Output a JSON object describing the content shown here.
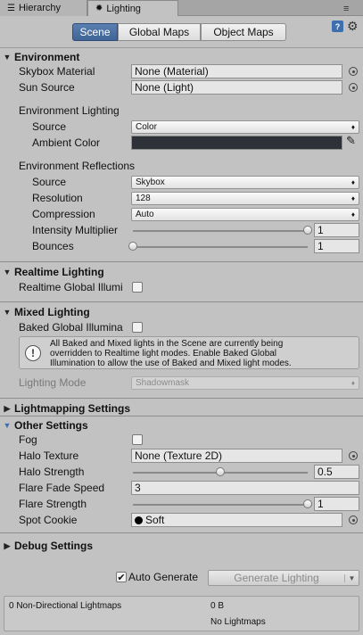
{
  "tabs": {
    "hierarchy": "Hierarchy",
    "lighting": "Lighting"
  },
  "toolbar": {
    "scene": "Scene",
    "global_maps": "Global Maps",
    "object_maps": "Object Maps"
  },
  "environment": {
    "title": "Environment",
    "skybox_label": "Skybox Material",
    "skybox_value": "None (Material)",
    "sun_label": "Sun Source",
    "sun_value": "None (Light)",
    "lighting_group": "Environment Lighting",
    "source_label": "Source",
    "source_value": "Color",
    "ambient_label": "Ambient Color",
    "ambient_color": "#2e3137",
    "reflections_group": "Environment Reflections",
    "refl_source_label": "Source",
    "refl_source_value": "Skybox",
    "resolution_label": "Resolution",
    "resolution_value": "128",
    "compression_label": "Compression",
    "compression_value": "Auto",
    "intensity_label": "Intensity Multiplier",
    "intensity_value": "1",
    "intensity_fraction": 1.0,
    "bounces_label": "Bounces",
    "bounces_value": "1",
    "bounces_fraction": 0.0
  },
  "realtime": {
    "title": "Realtime Lighting",
    "gi_label": "Realtime Global Illumi",
    "gi_checked": false
  },
  "mixed": {
    "title": "Mixed Lighting",
    "baked_label": "Baked Global Illumina",
    "baked_checked": false,
    "help_line1": "All Baked and Mixed lights in the Scene are currently being",
    "help_line2": "overridden to Realtime light modes. Enable Baked Global",
    "help_line3": "Illumination to allow the use of Baked and Mixed light modes.",
    "mode_label": "Lighting Mode",
    "mode_value": "Shadowmask"
  },
  "lightmapping": {
    "title": "Lightmapping Settings"
  },
  "other": {
    "title": "Other Settings",
    "fog_label": "Fog",
    "fog_checked": false,
    "halo_tex_label": "Halo Texture",
    "halo_tex_value": "None (Texture 2D)",
    "halo_strength_label": "Halo Strength",
    "halo_strength_value": "0.5",
    "halo_strength_fraction": 0.5,
    "flare_fade_label": "Flare Fade Speed",
    "flare_fade_value": "3",
    "flare_strength_label": "Flare Strength",
    "flare_strength_value": "1",
    "flare_strength_fraction": 1.0,
    "spot_cookie_label": "Spot Cookie",
    "spot_cookie_value": "Soft"
  },
  "debug": {
    "title": "Debug Settings"
  },
  "footer": {
    "auto_generate_label": "Auto Generate",
    "auto_generate_checked": true,
    "generate_button": "Generate Lighting",
    "lightmaps_count": "0 Non-Directional Lightmaps",
    "lightmaps_size": "0 B",
    "lightmaps_status": "No Lightmaps"
  },
  "colors": {
    "accent": "#3f6496",
    "help_icon": "#3d6fb0"
  }
}
